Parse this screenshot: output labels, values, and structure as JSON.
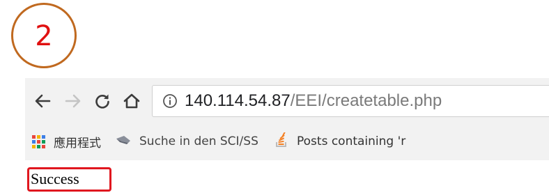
{
  "annotation": {
    "step_number": "2",
    "circle_color": "#c0691f",
    "number_color": "#e01010",
    "highlight_color": "#e0171f"
  },
  "browser": {
    "nav": {
      "back_icon": "arrow-left-icon",
      "forward_icon": "arrow-right-icon",
      "reload_icon": "reload-icon",
      "home_icon": "home-icon"
    },
    "address_bar": {
      "security_icon": "info-icon",
      "host": "140.114.54.87",
      "path": "/EEI/createtable.php"
    },
    "bookmarks": [
      {
        "icon": "apps-grid-icon",
        "label": "應用程式"
      },
      {
        "icon": "bookmark-favicon-icon",
        "label": "Suche in den SCI/SS"
      },
      {
        "icon": "stackoverflow-icon",
        "label": "Posts containing 'r"
      }
    ]
  },
  "page": {
    "body_text": "Success"
  }
}
